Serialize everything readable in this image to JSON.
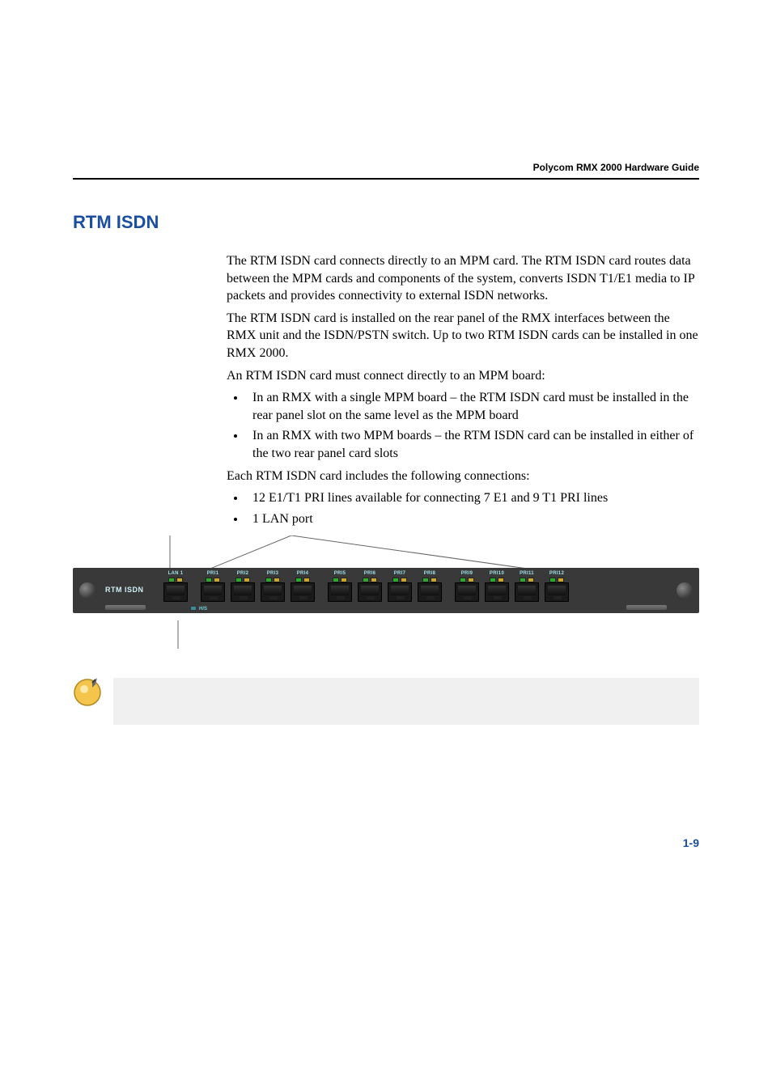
{
  "header": {
    "title": "Polycom RMX 2000 Hardware Guide"
  },
  "section": {
    "title": "RTM ISDN",
    "p1": "The RTM ISDN card connects directly to an MPM card. The RTM ISDN card routes data between the MPM cards and components of the system, converts ISDN T1/E1 media to IP packets and provides connectivity to external ISDN networks.",
    "p2": "The RTM ISDN card is installed on the rear panel of the RMX interfaces between the RMX unit and the ISDN/PSTN switch. Up to two RTM ISDN cards can be installed in one RMX 2000.",
    "p3": "An RTM ISDN card must connect directly to an MPM board:",
    "bullets1": [
      "In an RMX with a single MPM board – the RTM ISDN card must be installed in the rear panel slot on the same level as the MPM board",
      "In an RMX with two MPM boards – the RTM ISDN card can be installed in either of the two rear panel card slots"
    ],
    "p4": "Each RTM ISDN card includes the following connections:",
    "bullets2": [
      "12 E1/T1 PRI lines available for connecting 7 E1 and 9 T1 PRI lines",
      "1 LAN port"
    ]
  },
  "card": {
    "label": "RTM ISDN",
    "lan_label": "LAN 1",
    "pri_labels": [
      "PRI1",
      "PRI2",
      "PRI3",
      "PRI4",
      "PRI5",
      "PRI6",
      "PRI7",
      "PRI8",
      "PRI9",
      "PRI10",
      "PRI11",
      "PRI12"
    ],
    "hs_label": "H/S"
  },
  "page_number": "1-9"
}
